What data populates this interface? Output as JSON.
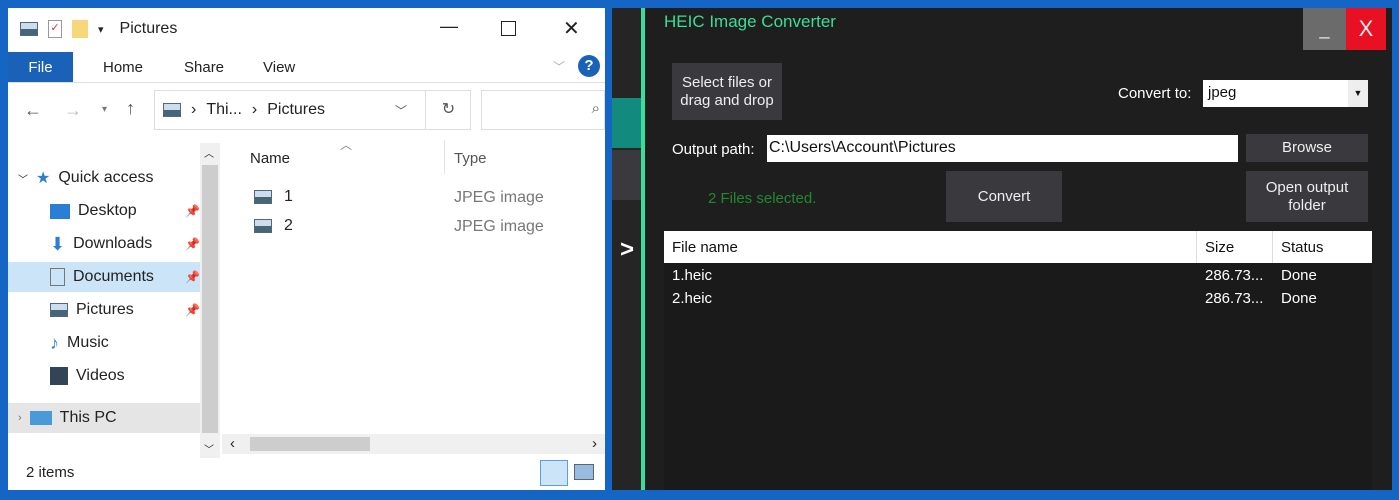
{
  "explorer": {
    "title": "Pictures",
    "tabs": [
      "File",
      "Home",
      "Share",
      "View"
    ],
    "breadcrumb": [
      "Thi...",
      "Pictures"
    ],
    "nav": [
      {
        "label": "Quick access"
      },
      {
        "label": "Desktop",
        "pinned": true
      },
      {
        "label": "Downloads",
        "pinned": true
      },
      {
        "label": "Documents",
        "pinned": true
      },
      {
        "label": "Pictures",
        "pinned": true
      },
      {
        "label": "Music"
      },
      {
        "label": "Videos"
      },
      {
        "label": "This PC"
      }
    ],
    "columns": [
      "Name",
      "Type"
    ],
    "files": [
      {
        "name": "1",
        "type": "JPEG image"
      },
      {
        "name": "2",
        "type": "JPEG image"
      }
    ],
    "status": "2 items"
  },
  "converter": {
    "title": "HEIC Image Converter",
    "minimize": "_",
    "close": "X",
    "select_files": "Select files or drag and drop",
    "convert_to_label": "Convert to:",
    "format": "jpeg",
    "output_label": "Output path:",
    "output_path": "C:\\Users\\Account\\Pictures",
    "browse": "Browse",
    "status": "2 Files selected.",
    "convert": "Convert",
    "open_folder": "Open output folder",
    "expand": ">",
    "columns": [
      "File name",
      "Size",
      "Status"
    ],
    "rows": [
      {
        "name": "1.heic",
        "size": "286.73...",
        "status": "Done"
      },
      {
        "name": "2.heic",
        "size": "286.73...",
        "status": "Done"
      }
    ],
    "colors": {
      "accent": "#3ddc97",
      "close": "#e81123"
    }
  }
}
